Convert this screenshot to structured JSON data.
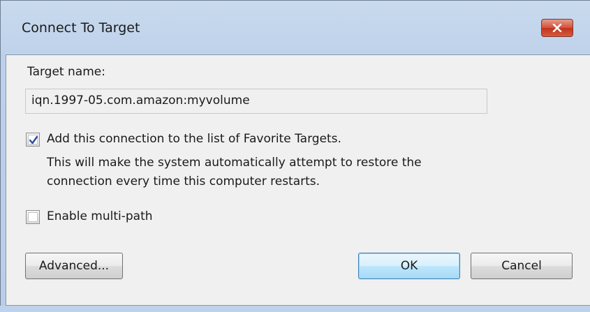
{
  "window": {
    "title": "Connect To Target",
    "close_icon": "close-icon"
  },
  "target": {
    "label": "Target name:",
    "value": "iqn.1997-05.com.amazon:myvolume"
  },
  "favorites": {
    "checked": true,
    "label": "Add this connection to the list of Favorite Targets.",
    "description_line1": "This will make the system automatically attempt to restore the",
    "description_line2": "connection every time this computer restarts."
  },
  "multipath": {
    "checked": false,
    "label": "Enable multi-path"
  },
  "buttons": {
    "advanced": "Advanced...",
    "ok": "OK",
    "cancel": "Cancel"
  },
  "colors": {
    "titlebar": "#bcd0ea",
    "client": "#f0f0f0",
    "close_button": "#c2331c",
    "default_button_border": "#3c7fb1",
    "checkmark": "#2a4c9a"
  }
}
